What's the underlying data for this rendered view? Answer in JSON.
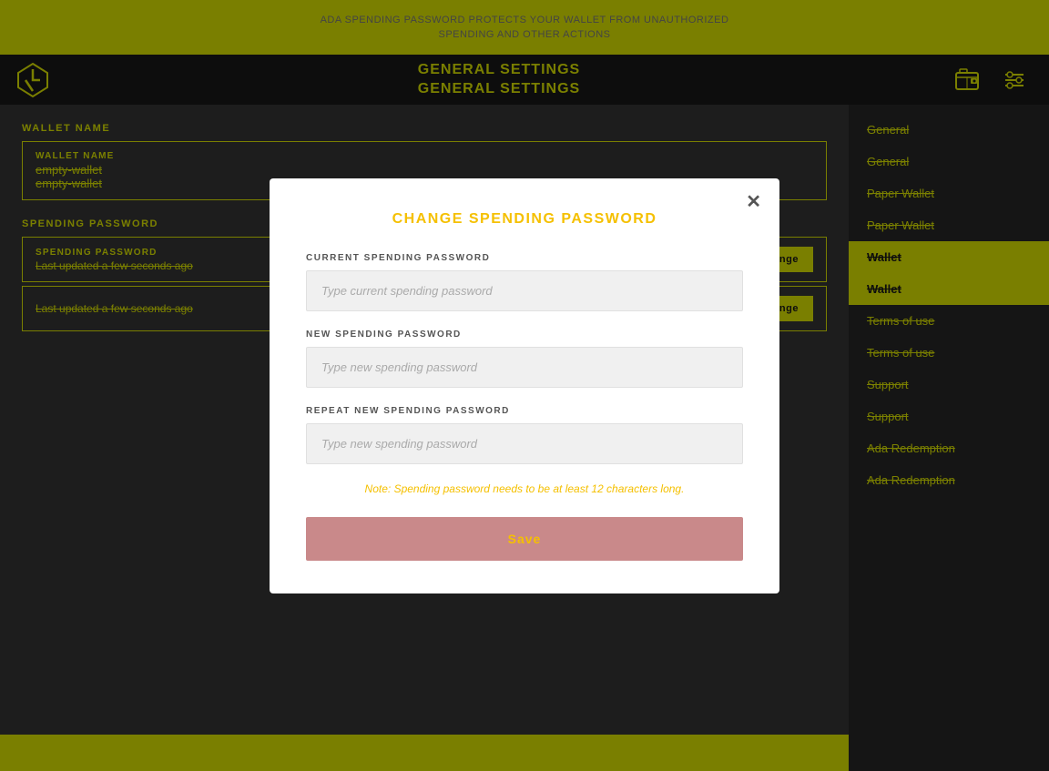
{
  "banner": {
    "line1": "ADA SPENDING PASSWORD PROTECTS YOUR WALLET FROM UNAUTHORIZED",
    "line2": "SPENDING AND OTHER ACTIONS"
  },
  "header": {
    "title_line1": "GENERAL SETTINGS",
    "title_line2": "GENERAL SETTINGS",
    "wallet_icon": "💼",
    "settings_icon": "⚙"
  },
  "content": {
    "wallet_name_label": "WALLET NAME",
    "wallet_name_field_label": "WALLET NAME",
    "wallet_name_value": "empty-wallet",
    "wallet_name_value2": "empty-wallet",
    "spending_password_label": "SPENDING PASSWORD",
    "spending_field_label": "SPENDING PASSWORD",
    "spending_last_updated1": "Last updated a few seconds ago",
    "spending_last_updated2": "Last updated a few seconds ago",
    "change_btn": "Change",
    "change_btn2": "Change"
  },
  "sidebar": {
    "items": [
      {
        "label": "General",
        "active": false
      },
      {
        "label": "General",
        "active": false
      },
      {
        "label": "Paper Wallet",
        "active": false
      },
      {
        "label": "Paper Wallet",
        "active": false
      },
      {
        "label": "Wallet",
        "active": true
      },
      {
        "label": "Wallet",
        "active": true
      },
      {
        "label": "Terms of use",
        "active": false
      },
      {
        "label": "Terms of use",
        "active": false
      },
      {
        "label": "Support",
        "active": false
      },
      {
        "label": "Support",
        "active": false
      },
      {
        "label": "Ada Redemption",
        "active": false
      },
      {
        "label": "Ada Redemption",
        "active": false
      }
    ]
  },
  "modal": {
    "title": "CHANGE SPENDING PASSWORD",
    "current_label": "CURRENT SPENDING PASSWORD",
    "current_placeholder": "Type current spending password",
    "new_label": "NEW SPENDING PASSWORD",
    "new_placeholder": "Type new spending password",
    "repeat_label": "REPEAT NEW SPENDING PASSWORD",
    "repeat_placeholder": "Type new spending password",
    "note": "Note: Spending password needs to be at least 12 characters long.",
    "save_btn": "Save"
  }
}
